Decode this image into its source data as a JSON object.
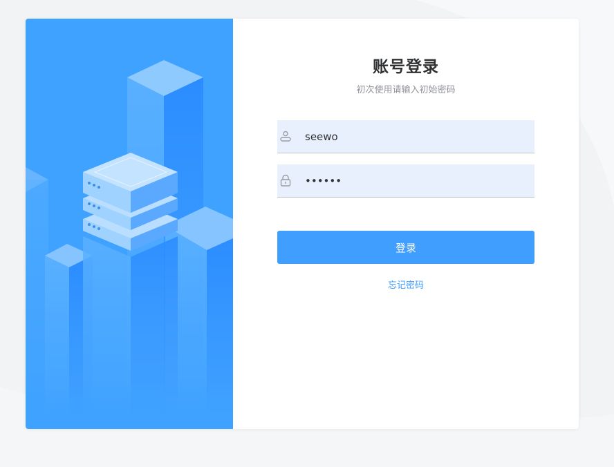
{
  "login": {
    "title": "账号登录",
    "subtitle": "初次使用请输入初始密码",
    "username_value": "seewo",
    "password_value": "••••••",
    "submit_label": "登录",
    "forgot_label": "忘记密码"
  },
  "icons": {
    "username": "user-icon",
    "password": "lock-icon"
  },
  "colors": {
    "primary": "#409eff",
    "panel_blue": "#3fa2ff",
    "input_bg": "#e8f0fe",
    "title": "#303133",
    "subtitle": "#909399"
  }
}
